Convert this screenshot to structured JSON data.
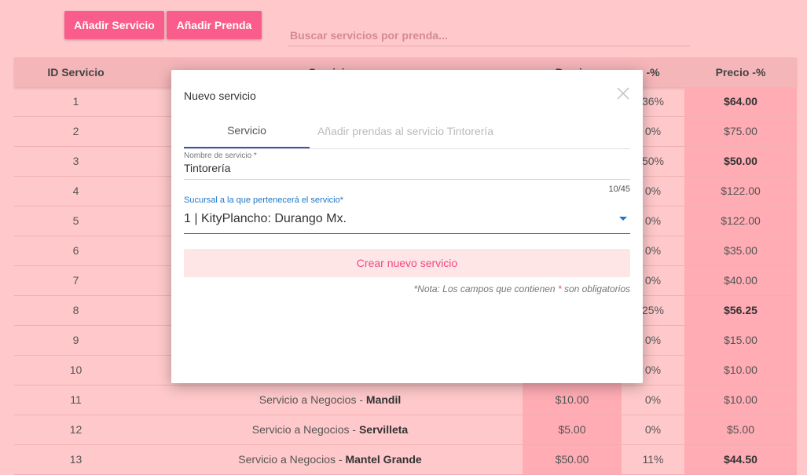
{
  "toolbar": {
    "add_service_label": "Añadir Servicio",
    "add_garment_label": "Añadir Prenda",
    "search_placeholder": "Buscar servicios por prenda..."
  },
  "table": {
    "headers": {
      "id": "ID Servicio",
      "name": "Servicio",
      "price": "Precio",
      "discount": "-%",
      "final": "Precio -%"
    },
    "rows": [
      {
        "id": "1",
        "discount": "36%",
        "final": "$64.00",
        "final_bold": true
      },
      {
        "id": "2",
        "discount": "0%",
        "final": "$75.00",
        "final_bold": false
      },
      {
        "id": "3",
        "discount": "50%",
        "final": "$50.00",
        "final_bold": true
      },
      {
        "id": "4",
        "discount": "0%",
        "final": "$122.00",
        "final_bold": false
      },
      {
        "id": "5",
        "discount": "0%",
        "final": "$122.00",
        "final_bold": false
      },
      {
        "id": "6",
        "discount": "0%",
        "final": "$35.00",
        "final_bold": false
      },
      {
        "id": "7",
        "discount": "0%",
        "final": "$40.00",
        "final_bold": false
      },
      {
        "id": "8",
        "discount": "25%",
        "final": "$56.25",
        "final_bold": true
      },
      {
        "id": "9",
        "discount": "0%",
        "final": "$15.00",
        "final_bold": false
      },
      {
        "id": "10",
        "discount": "0%",
        "final": "$10.00",
        "final_bold": false
      },
      {
        "id": "11",
        "name_prefix": "Servicio a Negocios - ",
        "name_item": "Mandil",
        "price": "$10.00",
        "discount": "0%",
        "final": "$10.00",
        "final_bold": false
      },
      {
        "id": "12",
        "name_prefix": "Servicio a Negocios - ",
        "name_item": "Servilleta",
        "price": "$5.00",
        "discount": "0%",
        "final": "$5.00",
        "final_bold": false
      },
      {
        "id": "13",
        "name_prefix": "Servicio a Negocios - ",
        "name_item": "Mantel Grande",
        "price": "$50.00",
        "discount": "11%",
        "final": "$44.50",
        "final_bold": true
      }
    ]
  },
  "modal": {
    "title": "Nuevo servicio",
    "tabs": [
      "Servicio",
      "Añadir prendas al servicio Tintorería"
    ],
    "name_label": "Nombre de servicio *",
    "name_value": "Tintorería",
    "counter": "10/45",
    "branch_label": "Sucursal a la que pertenecerá el servicio*",
    "branch_value": "1 | KityPlancho: Durango Mx.",
    "create_label": "Crear nuevo servicio",
    "note_prefix": "*Nota: Los campos que contienen ",
    "note_star": "*",
    "note_suffix": " son obligatorios"
  },
  "colors": {
    "accent": "#fa5c8b",
    "background": "#ffc9cb",
    "tab_indicator": "#3f51b5",
    "select_blue": "#1f77c8"
  }
}
